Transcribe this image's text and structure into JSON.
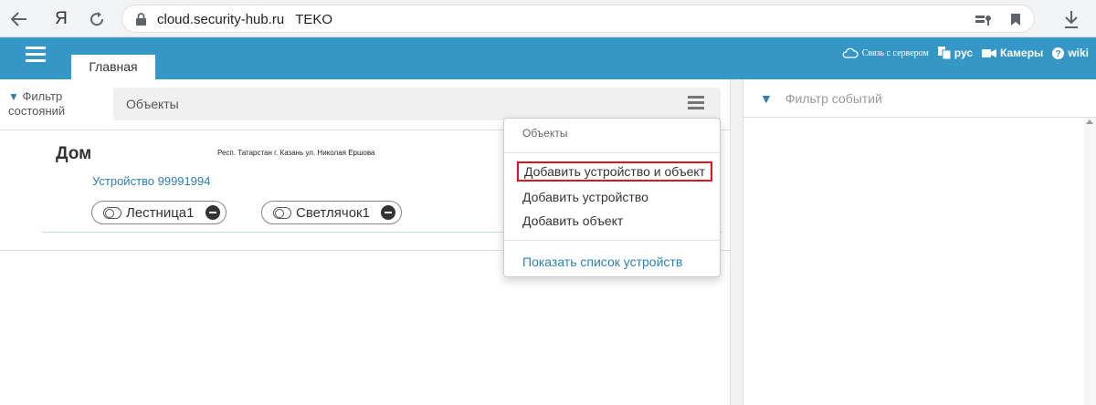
{
  "browser": {
    "url": "cloud.security-hub.ru",
    "page_title": "TEKO"
  },
  "header": {
    "tab_main": "Главная",
    "sync_label": "Связь с сервером",
    "lang_label": "рус",
    "cameras_label": "Камеры",
    "wiki_label": "wiki"
  },
  "left_panel": {
    "filter_line1": "Фильтр",
    "filter_line2": "состояний",
    "objects_label": "Объекты",
    "object": {
      "name": "Дом",
      "address": "Респ. Татарстан г. Казань ул. Николая Ершова",
      "device_link": "Устройство 99991994",
      "zones": [
        "Лестница1",
        "Светлячок1"
      ]
    }
  },
  "dropdown": {
    "header": "Объекты",
    "items": [
      "Добавить устройство и объект",
      "Добавить устройство",
      "Добавить объект"
    ],
    "link": "Показать список устройств",
    "highlight_color": "#e0141e"
  },
  "right_panel": {
    "filter_events": "Фильтр событий"
  },
  "colors": {
    "header_bg": "#3497c6",
    "link": "#2f7fb2"
  }
}
